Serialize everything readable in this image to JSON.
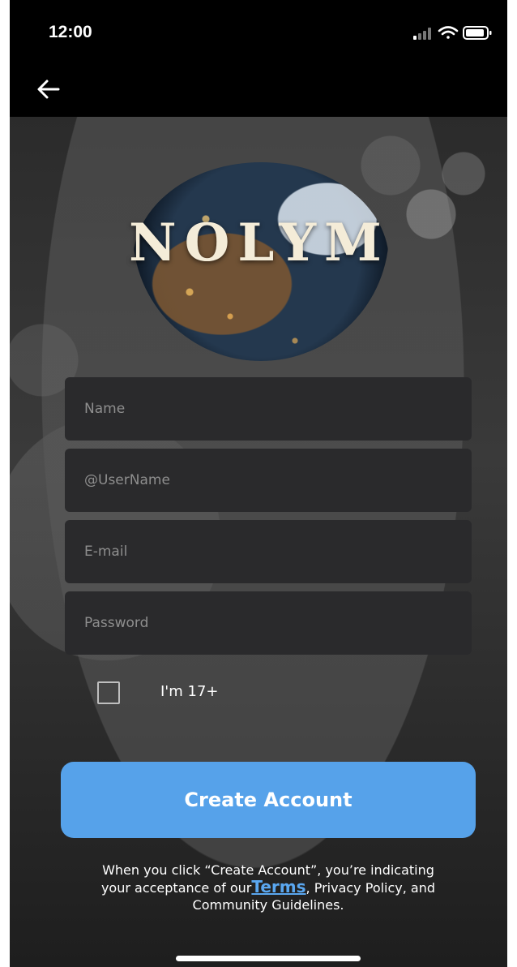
{
  "status_bar": {
    "time": "12:00"
  },
  "logo": {
    "text": "NOLYM"
  },
  "form": {
    "fields": [
      {
        "placeholder": "Name",
        "value": ""
      },
      {
        "placeholder": "@UserName",
        "value": ""
      },
      {
        "placeholder": "E-mail",
        "value": ""
      },
      {
        "placeholder": "Password",
        "value": ""
      }
    ],
    "age_label": "I'm 17+",
    "age_checked": false
  },
  "actions": {
    "create_label": "Create Account"
  },
  "disclaimer": {
    "line1": "When you click “Create Account”, you’re indicating",
    "prefix": "your acceptance of our",
    "terms_link": "Terms",
    "suffix": ", Privacy Policy, and",
    "line3": "Community Guidelines."
  },
  "colors": {
    "accent": "#56a2ea",
    "link": "#5aa7f0",
    "field_bg": "#2a2a2c"
  },
  "icons": [
    "signal-icon",
    "wifi-icon",
    "battery-icon",
    "back-arrow-icon"
  ]
}
